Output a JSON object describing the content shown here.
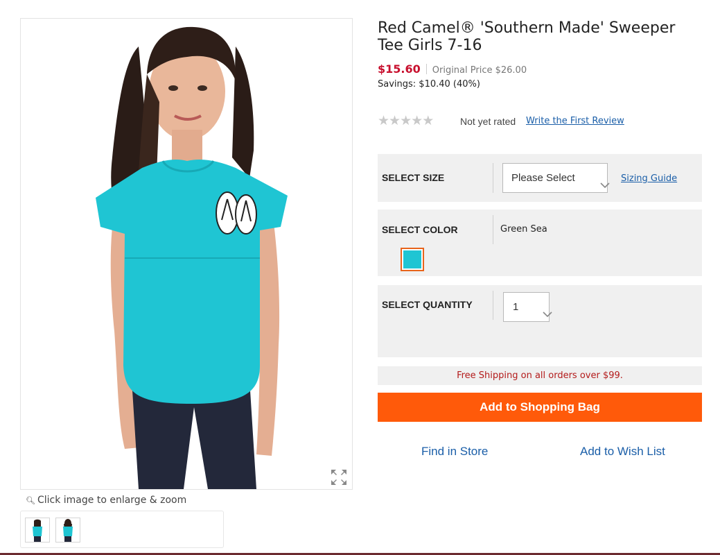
{
  "product": {
    "title": "Red Camel® 'Southern Made' Sweeper Tee Girls 7-16",
    "sale_price": "$15.60",
    "original_price": "Original Price $26.00",
    "savings": "Savings: $10.40 (40%)"
  },
  "rating": {
    "stars": 5,
    "filled": 0,
    "text": "Not yet rated",
    "review_link": "Write the First Review"
  },
  "size": {
    "label": "SELECT SIZE",
    "selected": "Please Select",
    "guide_link": "Sizing Guide"
  },
  "color": {
    "label": "SELECT COLOR",
    "selected_name": "Green Sea",
    "swatches": [
      {
        "name": "green-sea",
        "hex": "#1fc5d3"
      }
    ]
  },
  "quantity": {
    "label": "SELECT QUANTITY",
    "selected": "1"
  },
  "shipping_note": "Free Shipping on all orders over $99.",
  "buttons": {
    "add_to_bag": "Add to Shopping Bag",
    "find_in_store": "Find in Store",
    "add_to_wish_list": "Add to Wish List"
  },
  "gallery": {
    "zoom_hint": "Click image to enlarge & zoom",
    "thumbnail_count": 2
  },
  "colors": {
    "sale_price": "#c8102e",
    "link": "#1a5ea8",
    "add_to_bag_button": "#ff5a0a",
    "swatch_border": "#e8641b",
    "shirt": "#1fc5d3",
    "panel_bg": "#f0f0f0"
  },
  "icons": [
    "star-icon",
    "chevron-down-icon",
    "magnifier-icon",
    "expand-icon"
  ]
}
